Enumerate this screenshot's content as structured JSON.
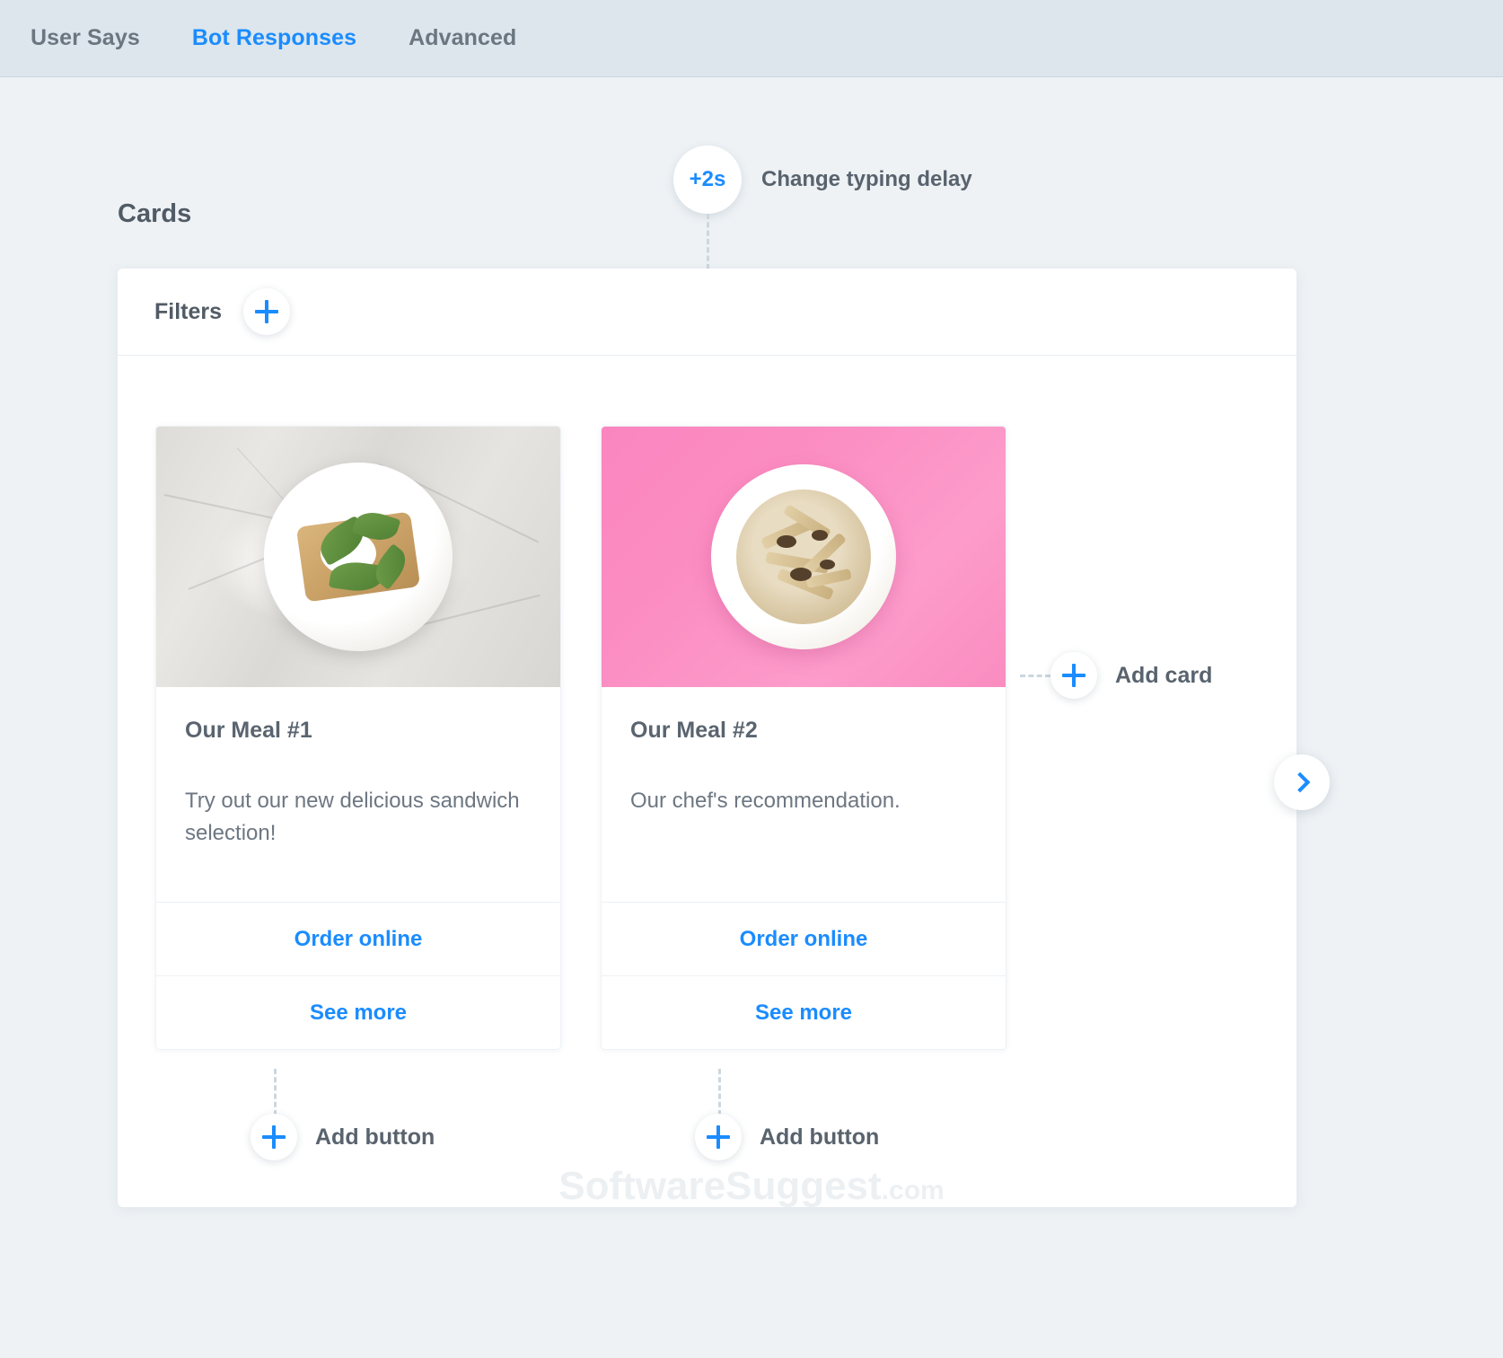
{
  "tabs": [
    {
      "label": "User Says",
      "active": false
    },
    {
      "label": "Bot Responses",
      "active": true
    },
    {
      "label": "Advanced",
      "active": false
    }
  ],
  "typing_delay": {
    "badge": "+2s",
    "label": "Change typing delay"
  },
  "section": {
    "title": "Cards"
  },
  "panel": {
    "filters_label": "Filters",
    "add_filter_icon": "plus-icon"
  },
  "cards": [
    {
      "title": "Our Meal #1",
      "description": "Try out our new delicious sandwich selection!",
      "image_alt": "avocado-toast-on-marble",
      "buttons": [
        {
          "label": "Order online"
        },
        {
          "label": "See more"
        }
      ],
      "add_button_label": "Add button"
    },
    {
      "title": "Our Meal #2",
      "description": "Our chef's recommendation.",
      "image_alt": "pasta-bowl-on-pink",
      "buttons": [
        {
          "label": "Order online"
        },
        {
          "label": "See more"
        }
      ],
      "add_button_label": "Add button"
    }
  ],
  "add_card": {
    "label": "Add card",
    "icon": "plus-icon"
  },
  "carousel": {
    "next_icon": "chevron-right-icon"
  },
  "watermark": {
    "name": "SoftwareSuggest",
    "tld": ".com"
  },
  "colors": {
    "accent_blue": "#1a8cff",
    "text_gray": "#59636e",
    "tab_inactive": "#6b7681",
    "page_bg": "#eef2f5",
    "tabbar_bg": "#dde6ec",
    "connector": "#ccd7de",
    "card2_image_pink": "#fb8dc2"
  }
}
